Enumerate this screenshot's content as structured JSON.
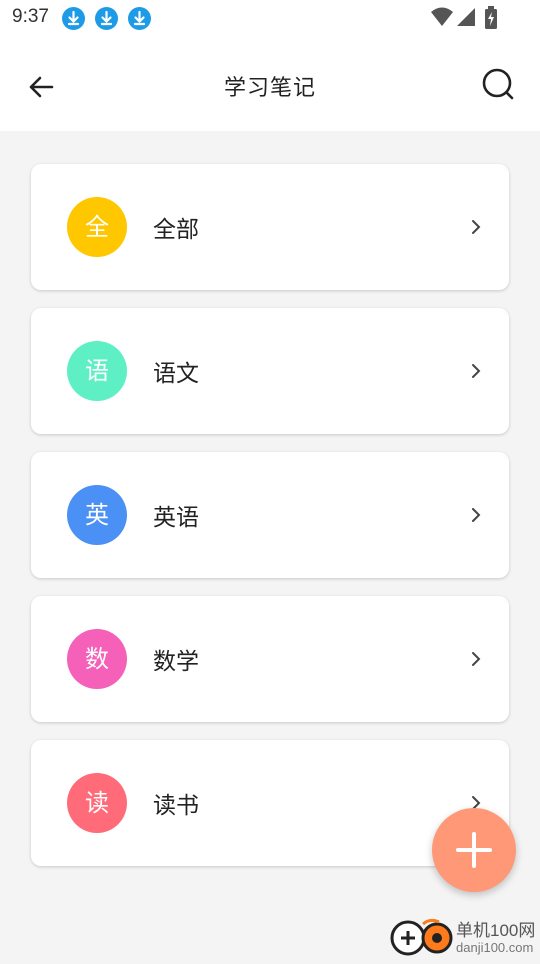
{
  "status_bar": {
    "time": "9:37",
    "notification_icons": [
      "download-icon",
      "download-icon",
      "download-icon"
    ],
    "right_icons": [
      "wifi-icon",
      "signal-icon",
      "battery-icon"
    ]
  },
  "app_bar": {
    "title": "学习笔记",
    "back_icon": "arrow-left-icon",
    "search_icon": "search-icon"
  },
  "categories": [
    {
      "label": "全部",
      "badge": "全",
      "color": "#ffc700"
    },
    {
      "label": "语文",
      "badge": "语",
      "color": "#5ef0c4"
    },
    {
      "label": "英语",
      "badge": "英",
      "color": "#4a90f5"
    },
    {
      "label": "数学",
      "badge": "数",
      "color": "#f560b8"
    },
    {
      "label": "读书",
      "badge": "读",
      "color": "#ff6b78"
    }
  ],
  "fab": {
    "icon": "plus-icon",
    "color": "#ff9877"
  },
  "watermark": {
    "line1": "单机100网",
    "line2": "danji100.com"
  }
}
